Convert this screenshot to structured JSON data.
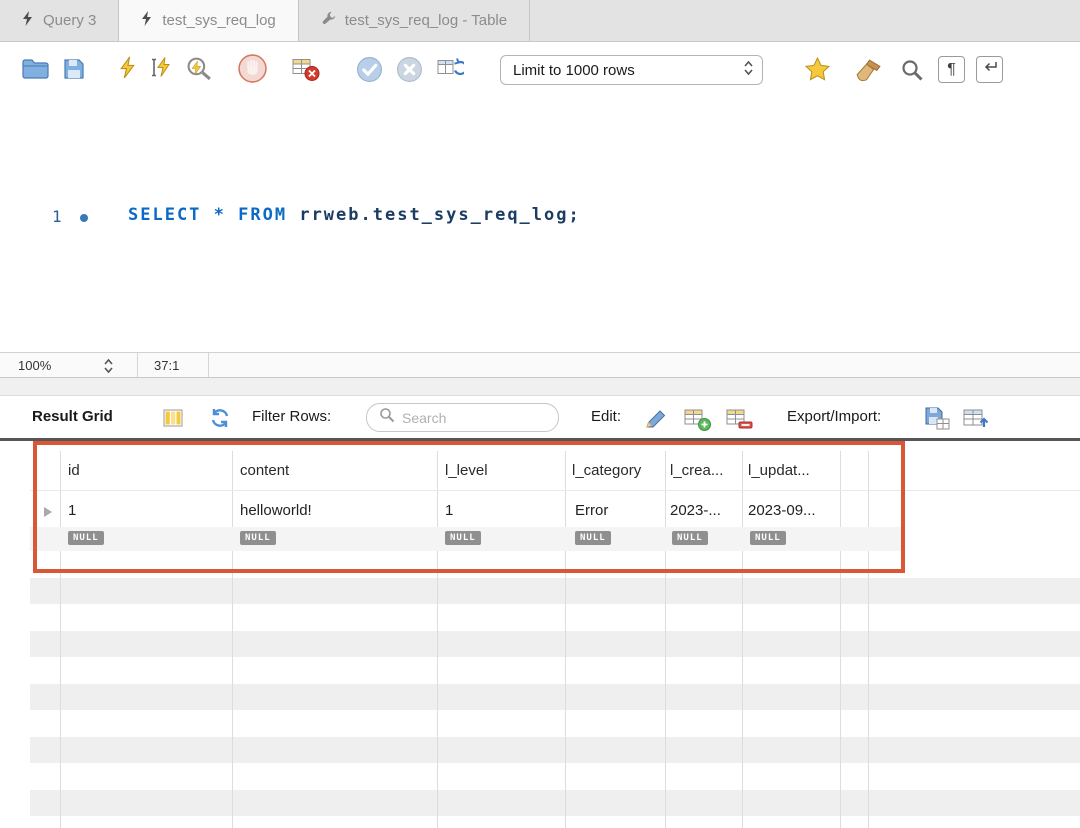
{
  "tabs": [
    {
      "label": "Query 3"
    },
    {
      "label": "test_sys_req_log"
    },
    {
      "label": "test_sys_req_log - Table"
    }
  ],
  "toolbar": {
    "limit_dropdown_value": "Limit to 1000 rows"
  },
  "editor": {
    "line_number": "1",
    "sql": {
      "select": "SELECT",
      "star": " * ",
      "from": "FROM",
      "identifier": " rrweb.test_sys_req_log;"
    }
  },
  "statusbar": {
    "zoom": "100%",
    "cursor_position": "37:1"
  },
  "result_toolbar": {
    "title": "Result Grid",
    "filter_label": "Filter Rows:",
    "search_placeholder": "Search",
    "edit_label": "Edit:",
    "export_label": "Export/Import:"
  },
  "result_grid": {
    "columns": [
      "id",
      "content",
      "l_level",
      "l_category",
      "l_crea...",
      "l_updat..."
    ],
    "rows": [
      [
        "1",
        "helloworld!",
        "1",
        "Error",
        "2023-...",
        "2023-09..."
      ]
    ],
    "null_placeholder": "NULL"
  },
  "colors": {
    "annotation_box": "#d95736",
    "keyword_blue": "#0b6ac6"
  }
}
